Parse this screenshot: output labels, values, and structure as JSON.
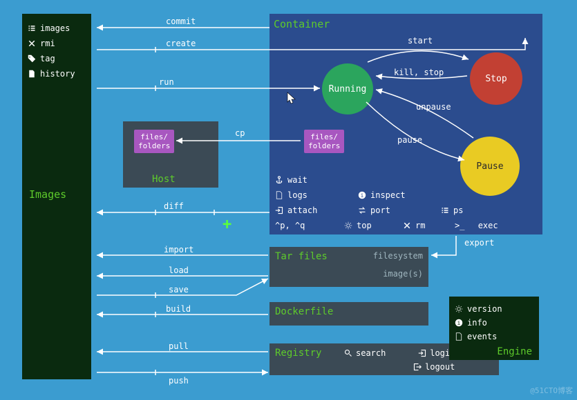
{
  "images_panel": {
    "title": "Images",
    "commands": [
      "images",
      "rmi",
      "tag",
      "history"
    ]
  },
  "container_panel": {
    "title": "Container",
    "states": {
      "running": "Running",
      "stop": "Stop",
      "pause": "Pause"
    },
    "transitions": {
      "start": "start",
      "kill_stop": "kill, stop",
      "pause": "pause",
      "unpause": "unpause"
    },
    "commands_grid": [
      [
        "wait",
        "",
        ""
      ],
      [
        "logs",
        "inspect",
        ""
      ],
      [
        "attach",
        "port",
        "ps"
      ],
      [
        "^p, ^q",
        "top",
        "rm",
        "exec"
      ]
    ]
  },
  "arrows": {
    "commit": "commit",
    "create": "create",
    "run": "run",
    "cp": "cp",
    "diff": "diff",
    "import": "import",
    "export": "export",
    "load": "load",
    "save": "save",
    "build": "build",
    "pull": "pull",
    "push": "push"
  },
  "host_panel": {
    "title": "Host",
    "files_folders": "files/\nfolders"
  },
  "tar_panel": {
    "title": "Tar files",
    "sub1": "filesystem",
    "sub2": "image(s)"
  },
  "dockerfile_panel": {
    "title": "Dockerfile"
  },
  "registry_panel": {
    "title": "Registry",
    "items": [
      "search",
      "login",
      "logout"
    ]
  },
  "engine_panel": {
    "title": "Engine",
    "items": [
      "version",
      "info",
      "events"
    ]
  },
  "watermark": "@51CTO博客"
}
